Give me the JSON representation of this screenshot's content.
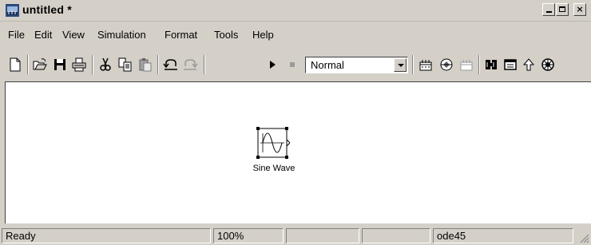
{
  "window": {
    "title": "untitled *",
    "min_label": "_",
    "close_label": "×"
  },
  "menu": [
    "File",
    "Edit",
    "View",
    "Simulation",
    "Format",
    "Tools",
    "Help"
  ],
  "toolbar": {
    "icons": [
      "new-model-icon",
      "open-icon",
      "save-icon",
      "print-icon",
      "cut-icon",
      "copy-icon",
      "paste-icon",
      "undo-icon",
      "redo-icon",
      "start-simulation-icon",
      "stop-simulation-icon",
      "build-icon",
      "update-diagram-icon",
      "build-subsystem-icon",
      "library-browser-icon",
      "model-explorer-icon",
      "go-to-parent-icon",
      "debugger-icon"
    ],
    "simulation_mode": "Normal"
  },
  "canvas": {
    "blocks": [
      {
        "name": "sine-wave-block",
        "label": "Sine Wave",
        "icon": "sine-wave-icon"
      }
    ]
  },
  "statusbar": {
    "status": "Ready",
    "zoom": "100%",
    "cell3": "",
    "cell4": "",
    "solver": "ode45"
  }
}
